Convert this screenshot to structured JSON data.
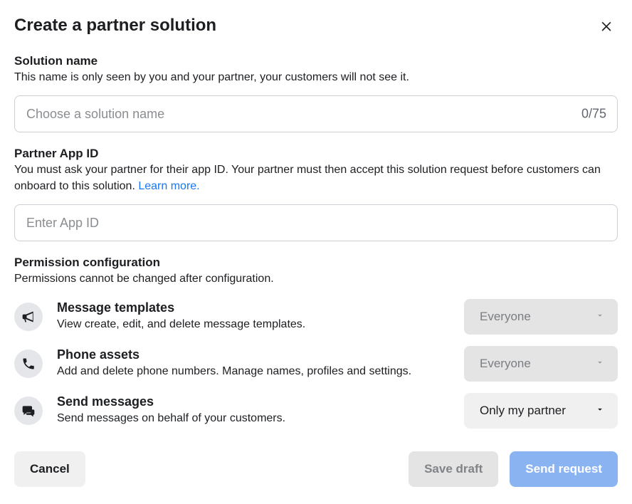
{
  "dialog": {
    "title": "Create a partner solution"
  },
  "solution_name": {
    "label": "Solution name",
    "desc": "This name is only seen by you and your partner, your customers will not see it.",
    "placeholder": "Choose a solution name",
    "value": "",
    "counter": "0/75"
  },
  "partner_app": {
    "label": "Partner App ID",
    "desc_pre": "You must ask your partner for their app ID. Your partner must then accept this solution request before customers can onboard to this solution. ",
    "learn_more": "Learn more.",
    "placeholder": "Enter App ID",
    "value": ""
  },
  "permission": {
    "label": "Permission configuration",
    "desc": "Permissions cannot be changed after configuration.",
    "rows": [
      {
        "icon": "megaphone-icon",
        "title": "Message templates",
        "desc": "View create, edit, and delete message templates.",
        "value": "Everyone",
        "enabled": false
      },
      {
        "icon": "phone-icon",
        "title": "Phone assets",
        "desc": "Add and delete phone numbers. Manage names, profiles and settings.",
        "value": "Everyone",
        "enabled": false
      },
      {
        "icon": "chat-icon",
        "title": "Send messages",
        "desc": "Send messages on behalf of your customers.",
        "value": "Only my partner",
        "enabled": true
      }
    ]
  },
  "footer": {
    "cancel": "Cancel",
    "save_draft": "Save draft",
    "send_request": "Send request"
  }
}
